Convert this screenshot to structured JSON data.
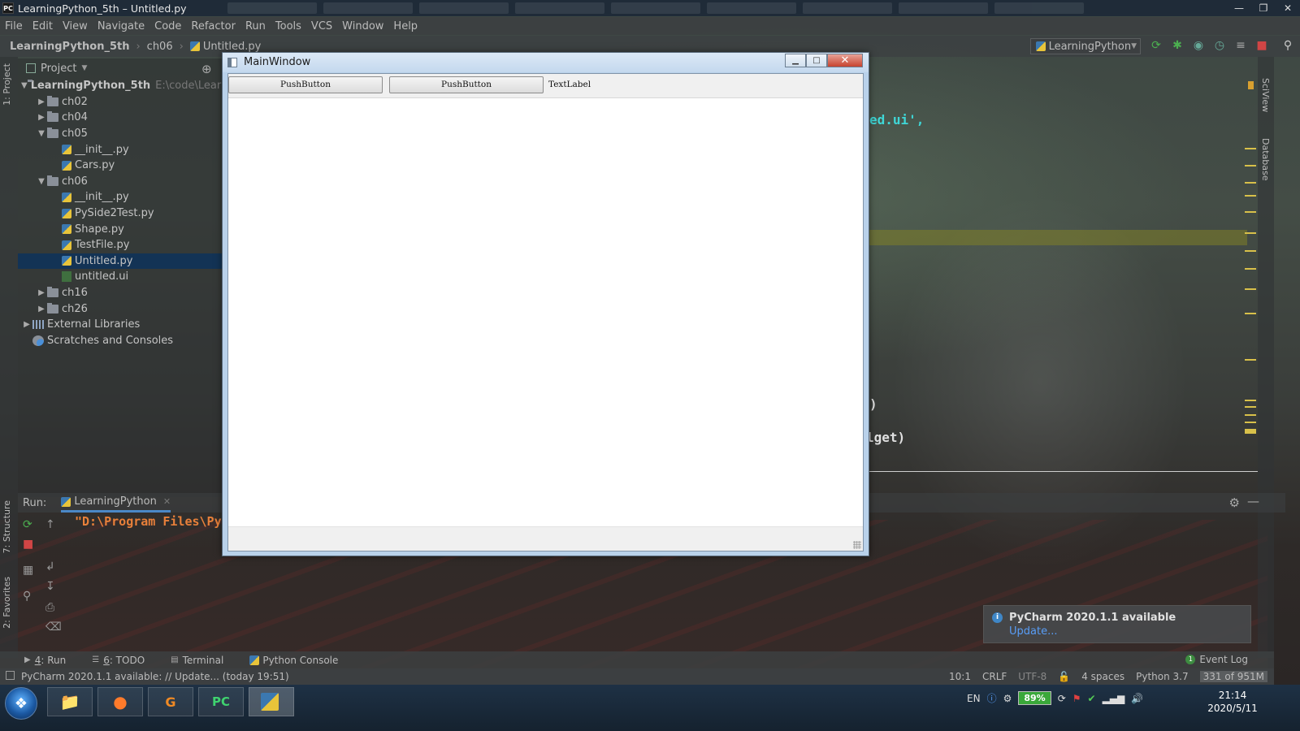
{
  "titlebar": {
    "title": "LearningPython_5th – Untitled.py",
    "icon_label": "PC",
    "controls": [
      "minimize",
      "maximize",
      "close"
    ]
  },
  "menu": [
    "File",
    "Edit",
    "View",
    "Navigate",
    "Code",
    "Refactor",
    "Run",
    "Tools",
    "VCS",
    "Window",
    "Help"
  ],
  "navbar": {
    "crumbs": [
      "LearningPython_5th",
      "ch06",
      "Untitled.py"
    ],
    "run_config": "LearningPython"
  },
  "project": {
    "header": "Project",
    "tree": [
      {
        "depth": 0,
        "type": "folder",
        "expanded": true,
        "label": "LearningPython_5th",
        "extra": "E:\\code\\LearnP"
      },
      {
        "depth": 1,
        "type": "folder",
        "expanded": false,
        "label": "ch02"
      },
      {
        "depth": 1,
        "type": "folder",
        "expanded": false,
        "label": "ch04"
      },
      {
        "depth": 1,
        "type": "folder",
        "expanded": true,
        "label": "ch05"
      },
      {
        "depth": 2,
        "type": "py",
        "label": "__init__.py"
      },
      {
        "depth": 2,
        "type": "py",
        "label": "Cars.py"
      },
      {
        "depth": 1,
        "type": "folder",
        "expanded": true,
        "label": "ch06"
      },
      {
        "depth": 2,
        "type": "py",
        "label": "__init__.py"
      },
      {
        "depth": 2,
        "type": "py",
        "label": "PySide2Test.py"
      },
      {
        "depth": 2,
        "type": "py",
        "label": "Shape.py"
      },
      {
        "depth": 2,
        "type": "py",
        "label": "TestFile.py"
      },
      {
        "depth": 2,
        "type": "py",
        "label": "Untitled.py",
        "selected": true
      },
      {
        "depth": 2,
        "type": "ui",
        "label": "untitled.ui"
      },
      {
        "depth": 1,
        "type": "folder",
        "expanded": false,
        "label": "ch16"
      },
      {
        "depth": 1,
        "type": "folder",
        "expanded": false,
        "label": "ch26"
      },
      {
        "depth": 0,
        "type": "lib",
        "expanded": false,
        "label": "External Libraries"
      },
      {
        "depth": 0,
        "type": "scratch",
        "label": "Scratches and Consoles"
      }
    ]
  },
  "left_stripe": {
    "project": "1: Project",
    "structure": "7: Structure",
    "favorites": "2: Favorites"
  },
  "right_stripe": {
    "sciview": "SciView",
    "database": "Database"
  },
  "editor": {
    "fragment1": "ed.ui',",
    "fragment2": ")",
    "fragment3": "lget)"
  },
  "run": {
    "label": "Run:",
    "tab": "LearningPython",
    "output": "\"D:\\Program Files\\Py"
  },
  "qt_window": {
    "title": "MainWindow",
    "button1": "PushButton",
    "button2": "PushButton",
    "label": "TextLabel"
  },
  "notification": {
    "title": "PyCharm 2020.1.1 available",
    "link": "Update..."
  },
  "toolwindows": [
    {
      "num": "4",
      "label": ": Run"
    },
    {
      "num": "6",
      "label": ": TODO"
    },
    {
      "num": "",
      "label": "Terminal"
    },
    {
      "num": "",
      "label": "Python Console"
    }
  ],
  "event_log": "Event Log",
  "event_count": "1",
  "status": {
    "message": "PyCharm 2020.1.1 available: // Update... (today 19:51)",
    "position": "10:1",
    "line_sep": "CRLF",
    "encoding": "UTF-8",
    "indent": "4 spaces",
    "interpreter": "Python 3.7",
    "memory": "331 of 951M"
  },
  "taskbar": {
    "lang": "EN",
    "battery": "89%",
    "time": "21:14",
    "date": "2020/5/11"
  },
  "colors": {
    "accent": "#4a88c7",
    "selection": "#0d325a",
    "run_output": "#e8803a",
    "code_cyan": "#3fd7d7"
  }
}
